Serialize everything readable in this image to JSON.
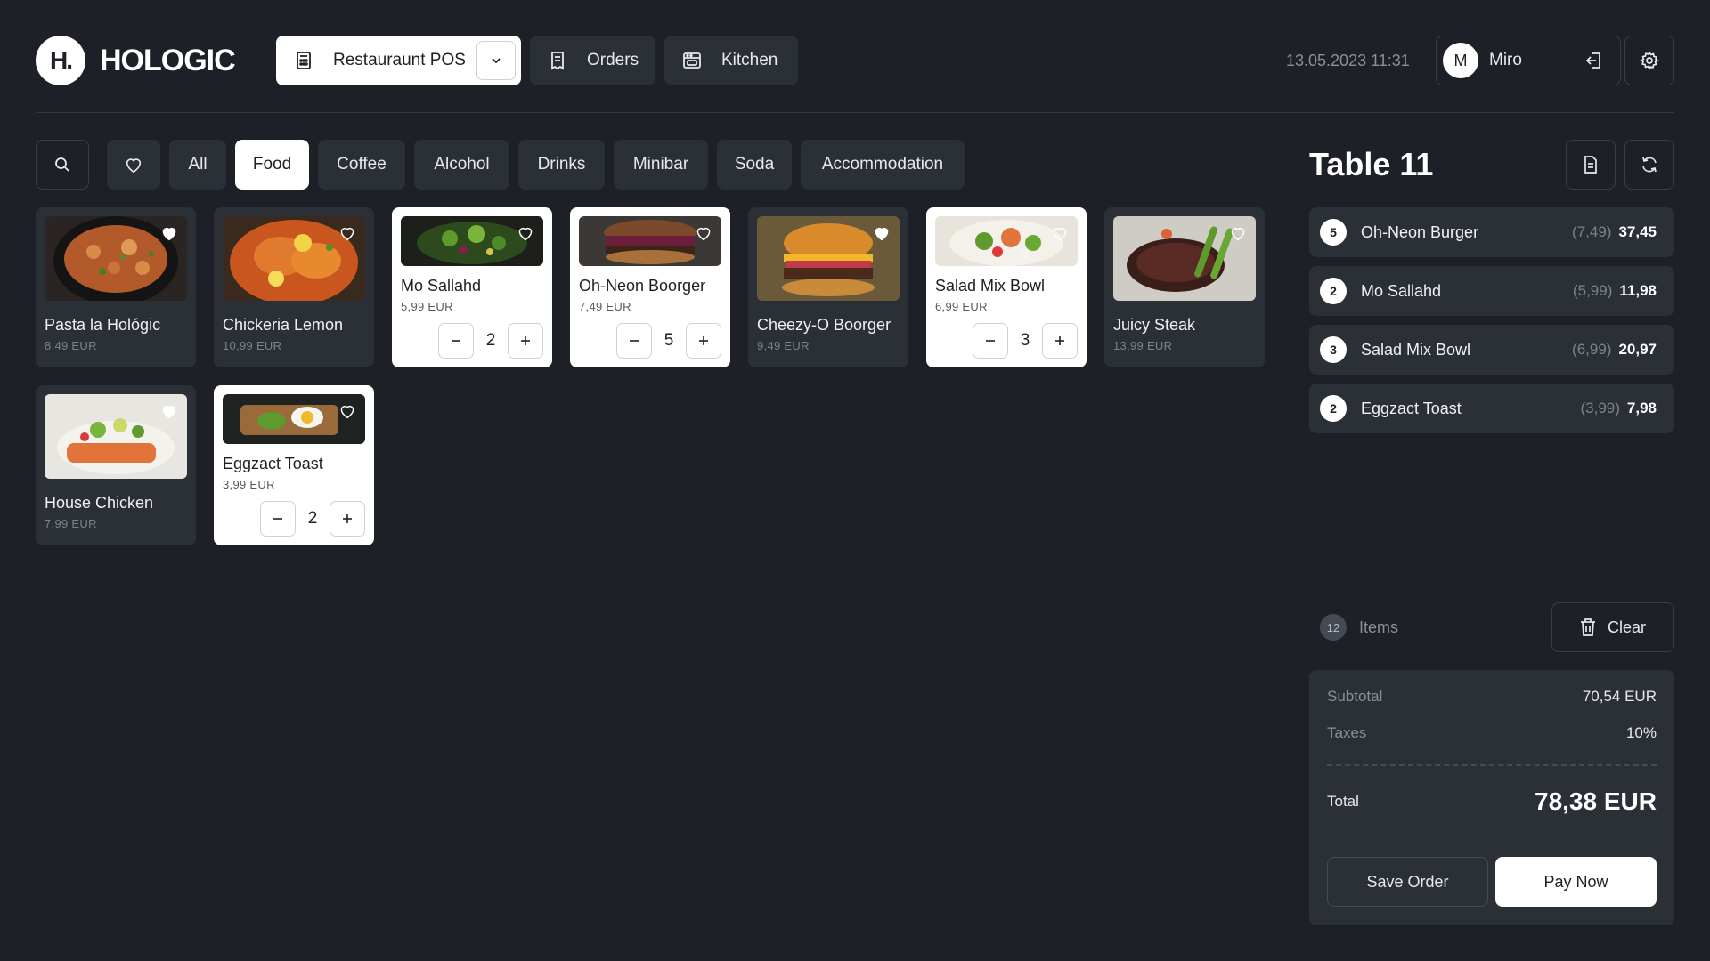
{
  "brand": {
    "mark": "H.",
    "name": "HOLOGIC"
  },
  "header": {
    "pos_label": "Restauraunt POS",
    "orders_label": "Orders",
    "kitchen_label": "Kitchen",
    "datetime": "13.05.2023 11:31",
    "user_initial": "M",
    "user_name": "Miro"
  },
  "filters": {
    "categories": [
      "All",
      "Food",
      "Coffee",
      "Alcohol",
      "Drinks",
      "Minibar",
      "Soda",
      "Accommodation"
    ],
    "active": "Food"
  },
  "products": [
    {
      "name": "Pasta la Hológic",
      "price": "8,49 EUR",
      "favorite": true,
      "selected": false
    },
    {
      "name": "Chickeria Lemon",
      "price": "10,99 EUR",
      "favorite": false,
      "selected": false
    },
    {
      "name": "Mo Sallahd",
      "price": "5,99 EUR",
      "favorite": false,
      "selected": true,
      "qty": "2"
    },
    {
      "name": "Oh-Neon Boorger",
      "price": "7,49 EUR",
      "favorite": false,
      "selected": true,
      "qty": "5"
    },
    {
      "name": "Cheezy-O Boorger",
      "price": "9,49 EUR",
      "favorite": true,
      "selected": false
    },
    {
      "name": "Salad Mix Bowl",
      "price": "6,99 EUR",
      "favorite": false,
      "selected": true,
      "qty": "3"
    },
    {
      "name": "Juicy Steak",
      "price": "13,99 EUR",
      "favorite": false,
      "selected": false
    },
    {
      "name": "House Chicken",
      "price": "7,99 EUR",
      "favorite": true,
      "selected": false
    },
    {
      "name": "Eggzact Toast",
      "price": "3,99 EUR",
      "favorite": false,
      "selected": true,
      "qty": "2"
    }
  ],
  "order": {
    "title": "Table 11",
    "items": [
      {
        "qty": "5",
        "name": "Oh-Neon Burger",
        "unit": "(7,49)",
        "total": "37,45"
      },
      {
        "qty": "2",
        "name": "Mo Sallahd",
        "unit": "(5,99)",
        "total": "11,98"
      },
      {
        "qty": "3",
        "name": "Salad Mix Bowl",
        "unit": "(6,99)",
        "total": "20,97"
      },
      {
        "qty": "2",
        "name": "Eggzact Toast",
        "unit": "(3,99)",
        "total": "7,98"
      }
    ],
    "items_count": "12",
    "items_label": "Items",
    "clear_label": "Clear"
  },
  "summary": {
    "subtotal_label": "Subtotal",
    "subtotal": "70,54 EUR",
    "taxes_label": "Taxes",
    "taxes": "10%",
    "total_label": "Total",
    "total": "78,38 EUR",
    "save_label": "Save Order",
    "pay_label": "Pay Now"
  },
  "colors": {
    "background": "#1d2026",
    "surface": "#2b2f36",
    "accent": "#ffffff"
  }
}
